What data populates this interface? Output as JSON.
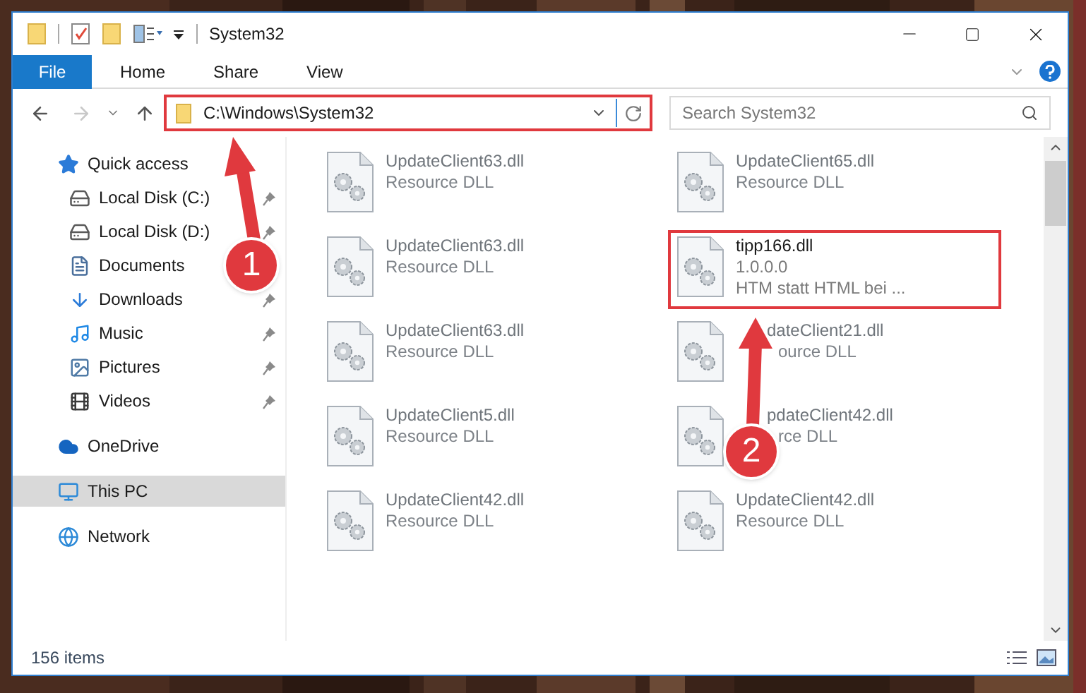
{
  "window": {
    "title": "System32"
  },
  "ribbon_tabs": [
    {
      "label": "File",
      "selected": true
    },
    {
      "label": "Home",
      "selected": false
    },
    {
      "label": "Share",
      "selected": false
    },
    {
      "label": "View",
      "selected": false
    }
  ],
  "address_bar": {
    "path": "C:\\Windows\\System32",
    "highlighted": true
  },
  "search": {
    "placeholder": "Search System32"
  },
  "nav_pane": [
    {
      "label": "Quick access",
      "kind": "star",
      "selected": false,
      "children": [
        {
          "label": "Local Disk (C:)",
          "kind": "disk-system",
          "pinned": true
        },
        {
          "label": "Local Disk (D:)",
          "kind": "disk",
          "pinned": true
        },
        {
          "label": "Documents",
          "kind": "documents",
          "pinned": false
        },
        {
          "label": "Downloads",
          "kind": "downloads",
          "pinned": true
        },
        {
          "label": "Music",
          "kind": "music",
          "pinned": true
        },
        {
          "label": "Pictures",
          "kind": "pictures",
          "pinned": true
        },
        {
          "label": "Videos",
          "kind": "videos",
          "pinned": true
        }
      ]
    },
    {
      "label": "OneDrive",
      "kind": "cloud",
      "selected": false
    },
    {
      "label": "This PC",
      "kind": "pc",
      "selected": true
    },
    {
      "label": "Network",
      "kind": "network",
      "selected": false
    }
  ],
  "files": [
    {
      "name": "UpdateClient63.dll",
      "type": "Resource DLL",
      "kind": "blurred",
      "highlighted": false
    },
    {
      "name": "UpdateClient65.dll",
      "type": "Resource DLL",
      "kind": "blurred",
      "highlighted": false
    },
    {
      "name": "UpdateClient63.dll",
      "type": "Resource DLL",
      "kind": "blurred",
      "highlighted": false
    },
    {
      "name": "tipp166.dll",
      "version": "1.0.0.0",
      "description": "HTM statt HTML bei ...",
      "kind": "detailed",
      "highlighted": true
    },
    {
      "name": "UpdateClient63.dll",
      "type": "Resource DLL",
      "kind": "blurred",
      "highlighted": false
    },
    {
      "name": "dateClient21.dll",
      "type": "ource DLL",
      "kind": "covered",
      "highlighted": false
    },
    {
      "name": "UpdateClient5.dll",
      "type": "Resource DLL",
      "kind": "blurred",
      "highlighted": false
    },
    {
      "name": "pdateClient42.dll",
      "type": "rce DLL",
      "kind": "covered",
      "highlighted": false
    },
    {
      "name": "UpdateClient42.dll",
      "type": "Resource DLL",
      "kind": "blurred",
      "highlighted": false
    },
    {
      "name": "UpdateClient42.dll",
      "type": "Resource DLL",
      "kind": "blurred",
      "highlighted": false
    }
  ],
  "status_bar": {
    "item_count": "156 items"
  },
  "callouts": [
    {
      "number": "1"
    },
    {
      "number": "2"
    }
  ]
}
